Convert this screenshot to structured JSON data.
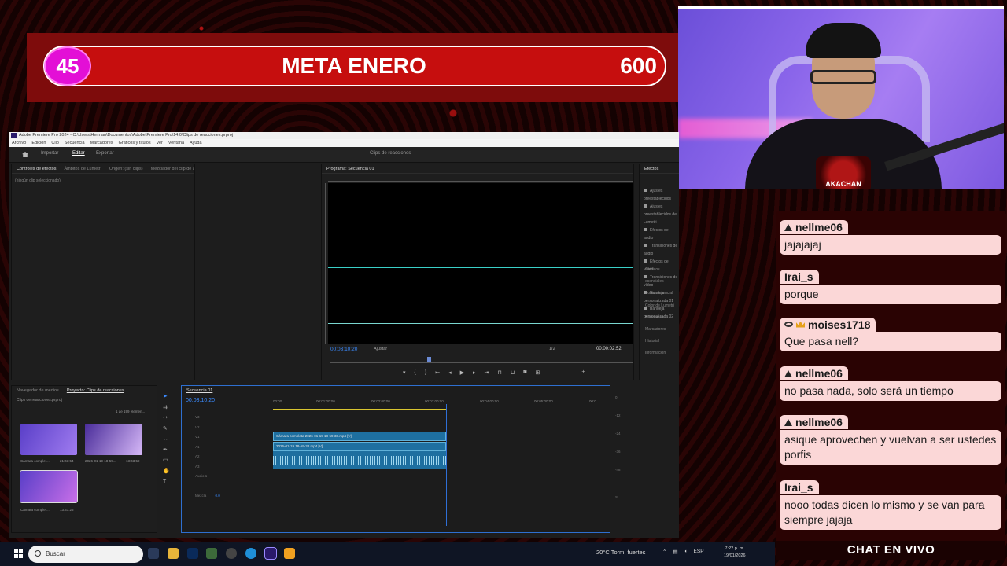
{
  "goal": {
    "count": "45",
    "title": "META ENERO",
    "target": "600"
  },
  "webcam": {
    "logo_text": "AKACHAN"
  },
  "premiere": {
    "title": "Adobe Premiere Pro 2024 - C:\\Users\\Herman\\Documentos\\Adobe\\Premiere Pro\\14.0\\Clips de reacciones.prproj",
    "menu": [
      "Archivo",
      "Edición",
      "Clip",
      "Secuencia",
      "Marcadores",
      "Gráficos y títulos",
      "Ver",
      "Ventana",
      "Ayuda"
    ],
    "workspace_tabs": [
      "Importar",
      "Editar",
      "Exportar"
    ],
    "project_name": "Clips de reacciones",
    "source_tabs": [
      "Controles de efectos",
      "Ámbitos de Lumetri",
      "Origen: (sin clips)",
      "Mezclador del clip de audio: Secuencia 01",
      "Mezclador de"
    ],
    "no_clip": "(ningún clip seleccionado)",
    "program_tab": "Programa: Secuencia 01",
    "program_timecode": "00:03:10:20",
    "fit_label": "Ajustar",
    "resolution": "1/2",
    "duration": "00:00:02:52",
    "effects_tab": "Efectos",
    "effects_folders": [
      "Ajustes preestablecidos",
      "Ajustes preestablecidos de Lumetri",
      "Efectos de audio",
      "Transiciones de audio",
      "Efectos de vídeo",
      "Transiciones de vídeo",
      "Bandeja personalizada 01",
      "Bandeja personalizada 02"
    ],
    "effects_sections": [
      "Gráficos esenciales",
      "Sonido esencial",
      "Color de Lumetri",
      "Bibliotecas",
      "Marcadores",
      "Historial",
      "Información"
    ],
    "project_tabs": [
      "Navegador de medios",
      "Proyecto: Clips de reacciones"
    ],
    "project_file": "Clips de reacciones.prproj",
    "items_count": "1 de 199 elemen...",
    "thumbs": [
      {
        "name": "Cámara complet...",
        "dur": "21:43:54"
      },
      {
        "name": "2026-01-19 18-59...",
        "dur": "13:43:59"
      },
      {
        "name": "Cámara complet...",
        "dur": "13:41:26"
      }
    ],
    "sequence_tab": "Secuencia 01",
    "timeline_timecode": "00:03:10:20",
    "ruler_marks": [
      "00:00",
      "00:01:00:00",
      "00:02:00:00",
      "00:03:00:00",
      "00:04:00:00",
      "00:05:00:00",
      "00:0"
    ],
    "clip_v2": "Cámara completa 2026-01-19 18-59-38.mp4 [V]",
    "clip_v1": "2026-01-19 18-59-38.mp4 [V]",
    "track_labels": [
      "V3",
      "V2",
      "V1",
      "A1",
      "A2",
      "A3",
      "Audio 1",
      "Mezcla"
    ],
    "mix_value": "0.0",
    "meter_labels": [
      "0",
      "-12",
      "-24",
      "-36",
      "-48",
      "S",
      "S"
    ]
  },
  "chat": {
    "messages": [
      {
        "user": "nellme06",
        "badge": "triangle",
        "text": "jajajajaj"
      },
      {
        "user": "Irai_s",
        "badge": "none",
        "text": "porque"
      },
      {
        "user": "moises1718",
        "badge": "eye-crown",
        "text": "Que pasa nell?"
      },
      {
        "user": "nellme06",
        "badge": "triangle",
        "text": "no pasa nada, solo será un tiempo"
      },
      {
        "user": "nellme06",
        "badge": "triangle",
        "text": "asique aprovechen y vuelvan a ser ustedes porfis"
      },
      {
        "user": "Irai_s",
        "badge": "none",
        "text": "nooo todas dicen lo mismo y se van para siempre jajaja"
      }
    ],
    "footer": "CHAT EN VIVO"
  },
  "taskbar": {
    "search_placeholder": "Buscar",
    "weather": "20°C  Torm. fuertes",
    "lang": "ESP",
    "time": "7:22 p. m.",
    "date": "19/01/2026"
  }
}
